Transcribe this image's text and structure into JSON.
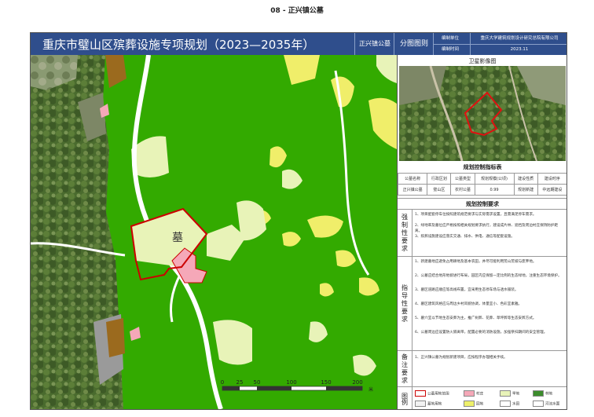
{
  "doc_title": "08 - 正兴镇公墓",
  "header": {
    "title": "重庆市璧山区殡葬设施专项规划（2023—2035年）",
    "site_name": "正兴镇公墓",
    "sheet_label": "分图图则",
    "org_label": "编制单位",
    "org_value": "重庆大学建筑规划设计研究总院有限公司",
    "date_label": "编制时间",
    "date_value": "2023.11"
  },
  "map": {
    "cemetery_label": "墓",
    "scale_ticks": [
      "0",
      "25",
      "50",
      "100",
      "150",
      "200"
    ],
    "scale_unit": "米"
  },
  "sidebar": {
    "satellite_title": "卫星影像图",
    "index_title": "规划控制指标表",
    "index_headers": [
      "公墓名称",
      "行政区划",
      "公墓类型",
      "规划规模(公顷)",
      "建设性质",
      "建设时序"
    ],
    "index_values": [
      "正兴镇公墓",
      "璧山区",
      "农村公墓",
      "0.99",
      "规划新建",
      "中远期建设"
    ],
    "requirements_title": "规划控制要求",
    "mandatory_label": "强制性要求",
    "mandatory_items": [
      "1、项目配套停车位按照建筑规范要求与实际需求设置，且需满足停车需求。",
      "2、绿地率及墓位应严格按照相关规划要求执行，建设成片林、遮挡及周边村庄保持防护距离。",
      "3、殡葬设施建设应落实交通、排水、供电、通信等配套设施。"
    ],
    "guidance_label": "指导性要求",
    "guidance_items": [
      "1、新建墓地应避免占用耕地及基本农田，并尽可能利用荒山荒坡与废弃地。",
      "2、公墓应结合地形地貌进行布局，园区内应保留一定比例的生态绿地，注重生态环境保护。",
      "3、墓区道路应顺应等高线布置，宜采用生态停车场与透水铺装。",
      "4、墓区建筑风格应与周边乡村风貌协调，体量宜小、色彩宜素雅。",
      "5、墓穴宜以节地生态安葬为主，推广树葬、花葬、草坪葬等生态安葬方式。",
      "6、公墓周边应设置防火隔离带，配置必要的消防设施，加强祭扫期间的安全管理。"
    ],
    "remarks_label": "备注要求",
    "remarks_items": [
      "1、正兴镇公墓为规划新建项目，应按程序办理相关手续。"
    ],
    "legend_label": "图例",
    "legend_items": [
      {
        "label": "公墓用地范围",
        "color": "#ffffff",
        "border": "#cc0000"
      },
      {
        "label": "墓地用地",
        "color": "#f2f2f2",
        "border": "#888888"
      },
      {
        "label": "旱地",
        "color": "#f4f8c8",
        "border": "#888888"
      },
      {
        "label": "林地",
        "color": "#3c8c2c",
        "border": "#888888"
      },
      {
        "label": "村庄",
        "color": "#f5a8b8",
        "border": "#888888"
      },
      {
        "label": "公路用地",
        "color": "#ffffff",
        "border": "#888888"
      },
      {
        "label": "园地",
        "color": "#eef06a",
        "border": "#888888"
      },
      {
        "label": "水田",
        "color": "#ffffff",
        "border": "#888888"
      },
      {
        "label": "河流水面",
        "color": "#ffffff",
        "border": "#888888"
      }
    ]
  },
  "colors": {
    "header_blue": "#2f4e8c",
    "forest": "#33aa00",
    "farmland_yellow": "#f0ee6a",
    "dry_land": "#e8f3b8",
    "village_pink": "#f5a8b8",
    "boundary_red": "#cc0000"
  }
}
